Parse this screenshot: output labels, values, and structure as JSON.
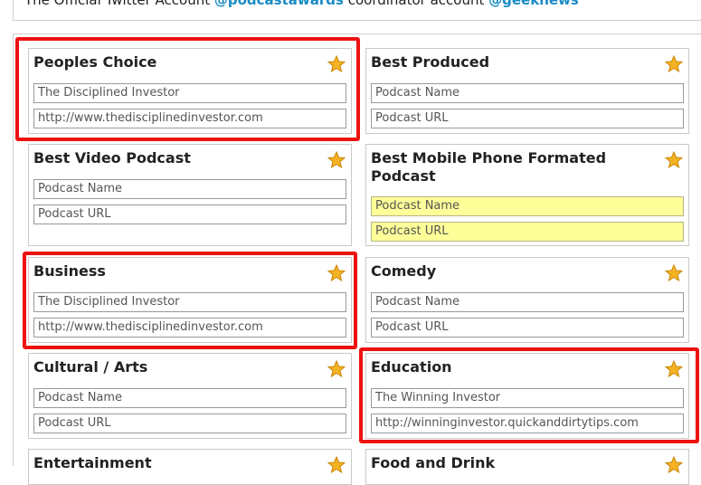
{
  "header": {
    "text_before": "The Official Twitter Account ",
    "link1": "@podcastawards",
    "text_middle": " coordinator account ",
    "link2": "@geeknews"
  },
  "colors": {
    "highlight": "#ee1111",
    "star": "#f5b324",
    "link": "#1a8bc4",
    "field_highlight": "#ffff99"
  },
  "icons": {
    "favorite": "star-icon"
  },
  "categories": [
    {
      "title": "Peoples Choice",
      "name": "The Disciplined Investor",
      "url": "http://www.thedisciplinedinvestor.com"
    },
    {
      "title": "Best Produced",
      "name": "Podcast Name",
      "url": "Podcast URL"
    },
    {
      "title": "Best Video Podcast",
      "name": "Podcast Name",
      "url": "Podcast URL"
    },
    {
      "title": "Best Mobile Phone Formated Podcast",
      "name": "Podcast Name",
      "url": "Podcast URL"
    },
    {
      "title": "Business",
      "name": "The Disciplined Investor",
      "url": "http://www.thedisciplinedinvestor.com"
    },
    {
      "title": "Comedy",
      "name": "Podcast Name",
      "url": "Podcast URL"
    },
    {
      "title": "Cultural / Arts",
      "name": "Podcast Name",
      "url": "Podcast URL"
    },
    {
      "title": "Education",
      "name": "The Winning Investor",
      "url": "http://winninginvestor.quickanddirtytips.com"
    },
    {
      "title": "Entertainment",
      "name": "",
      "url": ""
    },
    {
      "title": "Food and Drink",
      "name": "",
      "url": ""
    }
  ]
}
